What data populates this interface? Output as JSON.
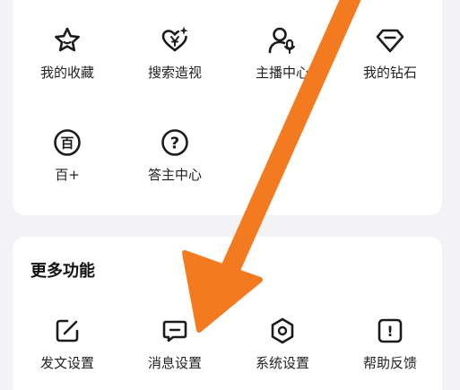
{
  "top_grid": {
    "row1": [
      {
        "label": "我的收藏",
        "icon": "star-icon"
      },
      {
        "label": "搜索造视",
        "icon": "heart-sparkle-icon"
      },
      {
        "label": "主播中心",
        "icon": "host-mic-icon"
      },
      {
        "label": "我的钻石",
        "icon": "diamond-icon"
      }
    ],
    "row2": [
      {
        "label": "百+",
        "icon": "bai-badge-icon",
        "icon_glyph": "百"
      },
      {
        "label": "答主中心",
        "icon": "question-icon",
        "icon_glyph": "?"
      }
    ]
  },
  "more_functions": {
    "title": "更多功能",
    "items": [
      {
        "label": "发文设置",
        "icon": "edit-square-icon"
      },
      {
        "label": "消息设置",
        "icon": "message-icon"
      },
      {
        "label": "系统设置",
        "icon": "hexagon-settings-icon"
      },
      {
        "label": "帮助反馈",
        "icon": "help-feedback-icon",
        "icon_glyph": "!"
      }
    ]
  },
  "colors": {
    "background": "#f3f3f5",
    "card": "#ffffff",
    "icon_stroke": "#1c1c1c",
    "annotation_arrow": "#f47a20"
  },
  "annotation": {
    "type": "arrow",
    "direction": "pointing down-left toward the message settings item"
  }
}
